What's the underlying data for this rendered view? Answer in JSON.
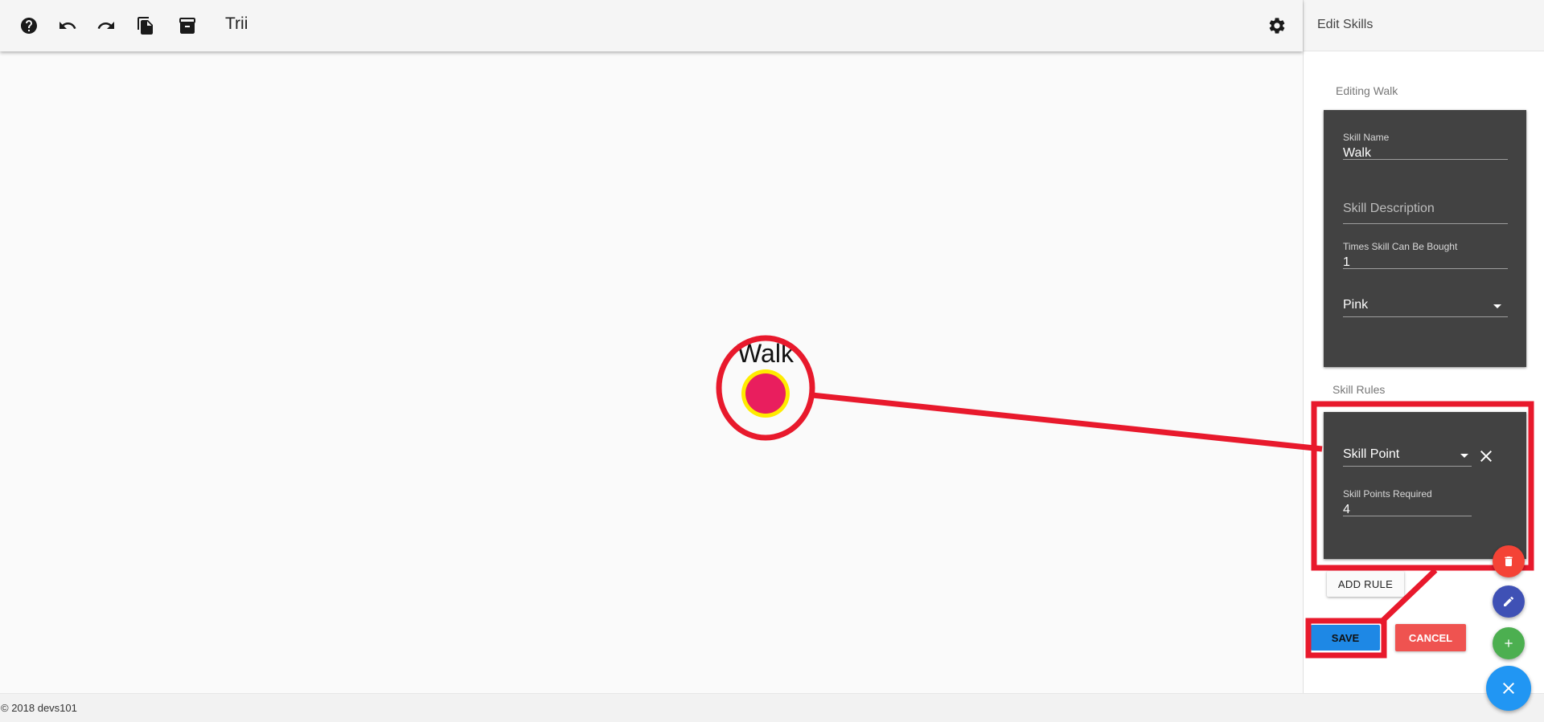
{
  "app": {
    "title": "Trii"
  },
  "toolbar": {
    "icons": [
      "help-icon",
      "undo-icon",
      "redo-icon",
      "copy-icon",
      "archive-icon",
      "settings-icon"
    ]
  },
  "canvas": {
    "node": {
      "label": "Walk",
      "fill_color": "#e91e5e",
      "ring_color": "#ffeb00"
    }
  },
  "sidebar": {
    "header": "Edit Skills",
    "editing_label": "Editing Walk",
    "skill_name": {
      "label": "Skill Name",
      "value": "Walk"
    },
    "skill_description": {
      "placeholder": "Skill Description"
    },
    "times_bought": {
      "label": "Times Skill Can Be Bought",
      "value": "1"
    },
    "color": {
      "value": "Pink"
    },
    "rules_label": "Skill Rules",
    "rule": {
      "type": "Skill Point",
      "points_label": "Skill Points Required",
      "points_value": "4"
    },
    "add_rule_label": "ADD RULE",
    "save_label": "SAVE",
    "cancel_label": "CANCEL"
  },
  "fabs": [
    "delete-icon",
    "edit-icon",
    "add-icon",
    "close-icon"
  ],
  "footer": {
    "text": "© 2018 devs101"
  },
  "colors": {
    "annotation": "#e8192c",
    "primary": "#1e88e5",
    "danger": "#ef5350",
    "success": "#4caf50",
    "indigo": "#3f51b5"
  }
}
